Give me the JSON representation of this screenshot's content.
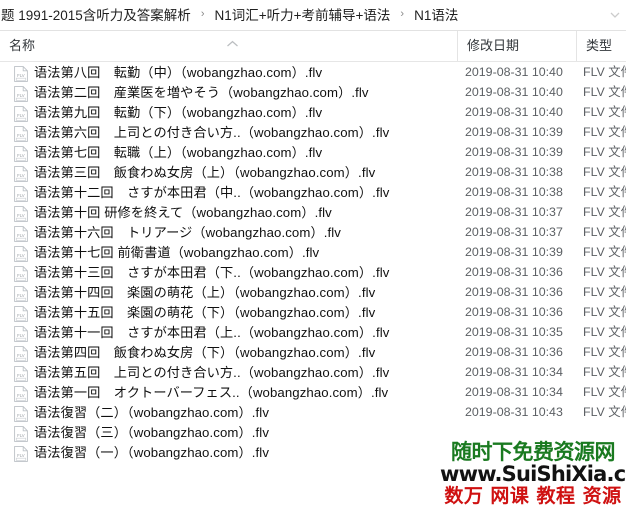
{
  "window": {
    "app": "file-explorer"
  },
  "address_bar": {
    "breadcrumbs": [
      "题 1991-2015含听力及答案解析",
      "N1词汇+听力+考前辅导+语法",
      "N1语法"
    ],
    "separator": "›",
    "dropdown_icon": "chevron-down-icon"
  },
  "columns": {
    "name": "名称",
    "date_modified": "修改日期",
    "type": "类型",
    "sort_indicator": "sort-ascending-caret"
  },
  "files": [
    {
      "name": "语法第八回　転勤（中）（wobangzhao.com）.flv",
      "date": "2019-08-31 10:40",
      "type": "FLV 文件"
    },
    {
      "name": "语法第二回　産業医を増やそう（wobangzhao.com）.flv",
      "date": "2019-08-31 10:40",
      "type": "FLV 文件"
    },
    {
      "name": "语法第九回　転勤（下）（wobangzhao.com）.flv",
      "date": "2019-08-31 10:40",
      "type": "FLV 文件"
    },
    {
      "name": "语法第六回　上司との付き合い方..（wobangzhao.com）.flv",
      "date": "2019-08-31 10:39",
      "type": "FLV 文件"
    },
    {
      "name": "语法第七回　転職（上）（wobangzhao.com）.flv",
      "date": "2019-08-31 10:39",
      "type": "FLV 文件"
    },
    {
      "name": "语法第三回　飯食わぬ女房（上）（wobangzhao.com）.flv",
      "date": "2019-08-31 10:38",
      "type": "FLV 文件"
    },
    {
      "name": "语法第十二回　さすが本田君（中..（wobangzhao.com）.flv",
      "date": "2019-08-31 10:38",
      "type": "FLV 文件"
    },
    {
      "name": "语法第十回 研修を終えて（wobangzhao.com）.flv",
      "date": "2019-08-31 10:37",
      "type": "FLV 文件"
    },
    {
      "name": "语法第十六回　トリアージ（wobangzhao.com）.flv",
      "date": "2019-08-31 10:37",
      "type": "FLV 文件"
    },
    {
      "name": "语法第十七回 前衛書道（wobangzhao.com）.flv",
      "date": "2019-08-31 10:39",
      "type": "FLV 文件"
    },
    {
      "name": "语法第十三回　さすが本田君（下..（wobangzhao.com）.flv",
      "date": "2019-08-31 10:36",
      "type": "FLV 文件"
    },
    {
      "name": "语法第十四回　楽園の萌花（上）（wobangzhao.com）.flv",
      "date": "2019-08-31 10:36",
      "type": "FLV 文件"
    },
    {
      "name": "语法第十五回　楽園の萌花（下）（wobangzhao.com）.flv",
      "date": "2019-08-31 10:36",
      "type": "FLV 文件"
    },
    {
      "name": "语法第十一回　さすが本田君（上..（wobangzhao.com）.flv",
      "date": "2019-08-31 10:35",
      "type": "FLV 文件"
    },
    {
      "name": "语法第四回　飯食わぬ女房（下）（wobangzhao.com）.flv",
      "date": "2019-08-31 10:36",
      "type": "FLV 文件"
    },
    {
      "name": "语法第五回　上司との付き合い方..（wobangzhao.com）.flv",
      "date": "2019-08-31 10:34",
      "type": "FLV 文件"
    },
    {
      "name": "语法第一回　オクトーバーフェス..（wobangzhao.com）.flv",
      "date": "2019-08-31 10:34",
      "type": "FLV 文件"
    },
    {
      "name": "语法復習（二）（wobangzhao.com）.flv",
      "date": "2019-08-31 10:43",
      "type": "FLV 文件"
    },
    {
      "name": "语法復習（三）（wobangzhao.com）.flv",
      "date": "",
      "type": ""
    },
    {
      "name": "语法復習（一）（wobangzhao.com）.flv",
      "date": "",
      "type": ""
    }
  ],
  "file_icon_label": "FLV",
  "watermark": {
    "line1": "随时下免费资源网",
    "line2": "www.SuiShiXia.com",
    "line3": "数万 网课 教程 资源",
    "colors": {
      "line1": "#1a7a20",
      "line2": "#121212",
      "line3": "#cf1111"
    }
  }
}
